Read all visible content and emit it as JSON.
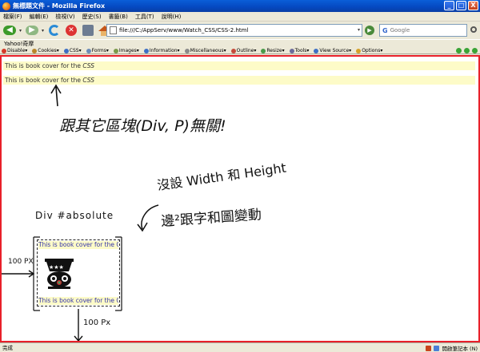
{
  "window": {
    "title": "無標題文件 - Mozilla Firefox",
    "buttons": [
      "_",
      "□",
      "X"
    ]
  },
  "menu": [
    "檔案(F)",
    "編輯(E)",
    "檢視(V)",
    "歷史(S)",
    "書籤(B)",
    "工具(T)",
    "說明(H)"
  ],
  "nav": {
    "url": "file:///C:/AppServ/www/Watch_CSS/CSS-2.html",
    "search_placeholder": "Google",
    "search_engine": "G"
  },
  "bookmarks": {
    "label": "Yahoo!奇摩"
  },
  "devtoolbar": {
    "items": [
      {
        "label": "Disable▾",
        "color": "#d43b2a"
      },
      {
        "label": "Cookies▾",
        "color": "#b8862a"
      },
      {
        "label": "CSS▾",
        "color": "#3d6fc4"
      },
      {
        "label": "Forms▾",
        "color": "#6b8bb8"
      },
      {
        "label": "Images▾",
        "color": "#7a9a4a"
      },
      {
        "label": "Information▾",
        "color": "#3d6fc4"
      },
      {
        "label": "Miscellaneous▾",
        "color": "#8a8a8a"
      },
      {
        "label": "Outline▾",
        "color": "#c44a3a"
      },
      {
        "label": "Resize▾",
        "color": "#4a9a4a"
      },
      {
        "label": "Tools▾",
        "color": "#6a6a9a"
      },
      {
        "label": "View Source▾",
        "color": "#3d6fc4"
      },
      {
        "label": "Options▾",
        "color": "#d4a02a"
      }
    ]
  },
  "content": {
    "line1": "This is book cover for the ",
    "line1_em": "CSS",
    "line2": "This is book cover for the ",
    "line2_em": "CSS",
    "box_top": "This is book cover for the CSS",
    "box_bottom": "This is book cover for the CSS",
    "note_relation": "跟其它區塊(Div, P)無關!",
    "note_div": "Div #absolute",
    "note_nowh": "沒設 Width 和 Height",
    "note_edge": "邊²跟字和圖變動",
    "note_left": "100 PX",
    "note_down": "100 Px"
  },
  "status": {
    "left": "完成",
    "right": "開啟筆記本 (N)"
  }
}
